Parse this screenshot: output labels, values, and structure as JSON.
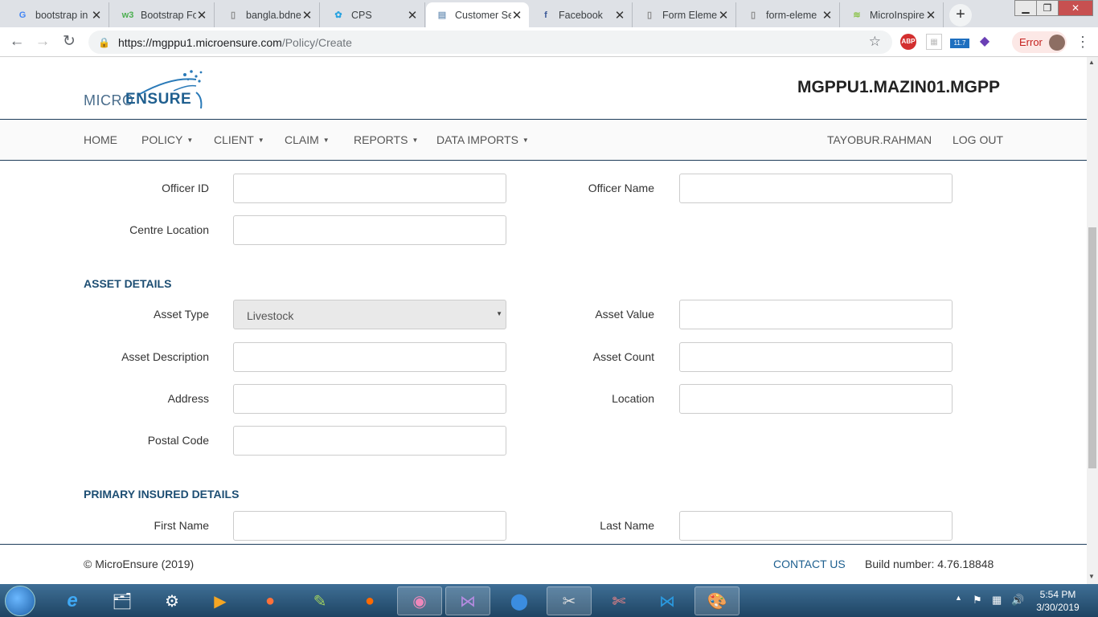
{
  "browser": {
    "tabs": [
      {
        "title": "bootstrap in",
        "icon": "google-icon",
        "color": "#4285f4",
        "glyph": "G"
      },
      {
        "title": "Bootstrap Fo",
        "icon": "w3schools-icon",
        "color": "#4caf50",
        "glyph": "w3"
      },
      {
        "title": "bangla.bdne",
        "icon": "page-icon",
        "color": "#888888",
        "glyph": "▯"
      },
      {
        "title": "CPS",
        "icon": "cps-icon",
        "color": "#29a3e0",
        "glyph": "✿"
      },
      {
        "title": "Customer Se",
        "icon": "doc-icon",
        "color": "#7f9fbf",
        "glyph": "▤"
      },
      {
        "title": "Facebook",
        "icon": "facebook-icon",
        "color": "#3b5998",
        "glyph": "f"
      },
      {
        "title": "Form Eleme",
        "icon": "page-icon",
        "color": "#888888",
        "glyph": "▯"
      },
      {
        "title": "form-eleme",
        "icon": "page-icon",
        "color": "#888888",
        "glyph": "▯"
      },
      {
        "title": "MicroInspire",
        "icon": "microinspire-icon",
        "color": "#8bc34a",
        "glyph": "≋"
      }
    ],
    "active_tab": 4,
    "url_host": "https://mgppu1.microensure.com",
    "url_path": "/Policy/Create",
    "error_label": "Error",
    "ext_badge": "11.7",
    "abp_label": "ABP"
  },
  "header": {
    "logo_micro": "MICRO",
    "logo_ensure": "ENSURE",
    "site_title": "MGPPU1.MAZIN01.MGPP"
  },
  "nav": {
    "home": "HOME",
    "policy": "POLICY",
    "client": "CLIENT",
    "claim": "CLAIM",
    "reports": "REPORTS",
    "data_imports": "DATA IMPORTS",
    "user": "TAYOBUR.RAHMAN",
    "logout": "LOG OUT"
  },
  "form": {
    "officer_id": "Officer ID",
    "officer_name": "Officer Name",
    "centre_location": "Centre Location",
    "asset_section": "ASSET DETAILS",
    "asset_type": "Asset Type",
    "asset_type_value": "Livestock",
    "asset_value": "Asset Value",
    "asset_description": "Asset Description",
    "asset_count": "Asset Count",
    "address": "Address",
    "location": "Location",
    "postal_code": "Postal Code",
    "insured_section": "PRIMARY INSURED DETAILS",
    "first_name": "First Name",
    "last_name": "Last Name"
  },
  "footer": {
    "copyright": "© MicroEnsure (2019)",
    "contact": "CONTACT US",
    "build": "Build number: 4.76.18848"
  },
  "taskbar": {
    "time": "5:54 PM",
    "date": "3/30/2019"
  }
}
